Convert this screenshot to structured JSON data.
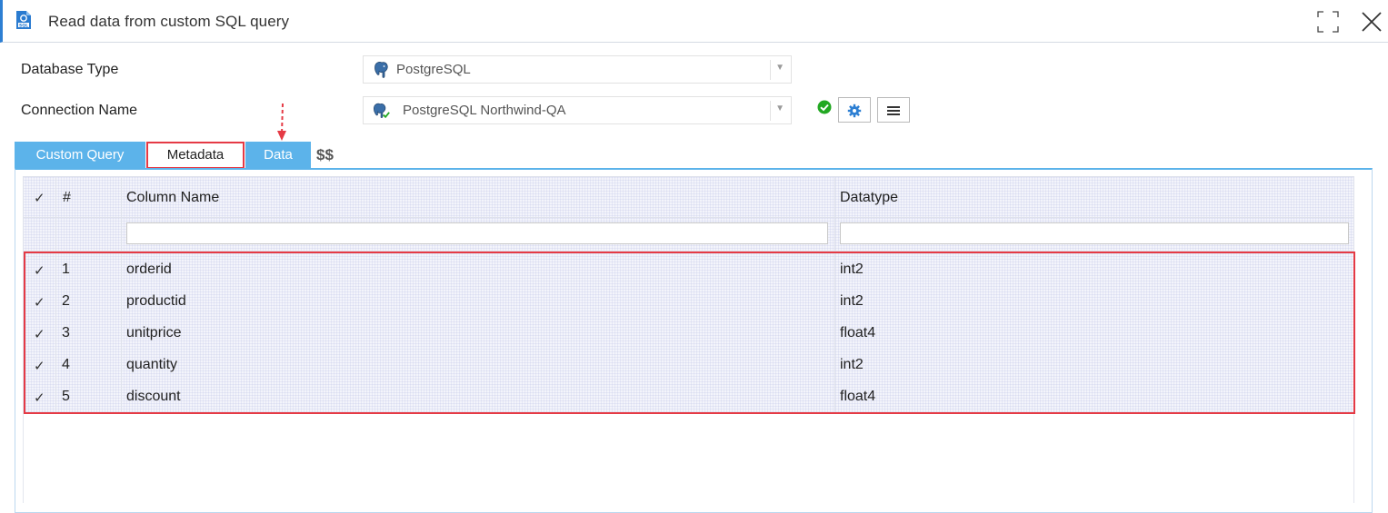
{
  "window": {
    "title": "Read data from custom SQL query",
    "icon": "sql-file-icon"
  },
  "form": {
    "database_type_label": "Database Type",
    "database_type_value": "PostgreSQL",
    "connection_name_label": "Connection Name",
    "connection_name_value": "PostgreSQL Northwind-QA"
  },
  "tabs": [
    {
      "label": "Custom Query",
      "active": false
    },
    {
      "label": "Metadata",
      "active": true
    },
    {
      "label": "Data",
      "active": false
    }
  ],
  "dollar_label": "$$",
  "grid": {
    "columns": {
      "check": "✓",
      "index": "#",
      "name": "Column Name",
      "type": "Datatype"
    },
    "filters": {
      "name": "",
      "type": ""
    },
    "rows": [
      {
        "check": "✓",
        "index": "1",
        "name": "orderid",
        "type": "int2"
      },
      {
        "check": "✓",
        "index": "2",
        "name": "productid",
        "type": "int2"
      },
      {
        "check": "✓",
        "index": "3",
        "name": "unitprice",
        "type": "float4"
      },
      {
        "check": "✓",
        "index": "4",
        "name": "quantity",
        "type": "int2"
      },
      {
        "check": "✓",
        "index": "5",
        "name": "discount",
        "type": "float4"
      }
    ]
  },
  "colors": {
    "accent": "#5cb3ea",
    "annotation": "#e53a45",
    "status_ok": "#22a822",
    "gear": "#2d7fd3"
  }
}
